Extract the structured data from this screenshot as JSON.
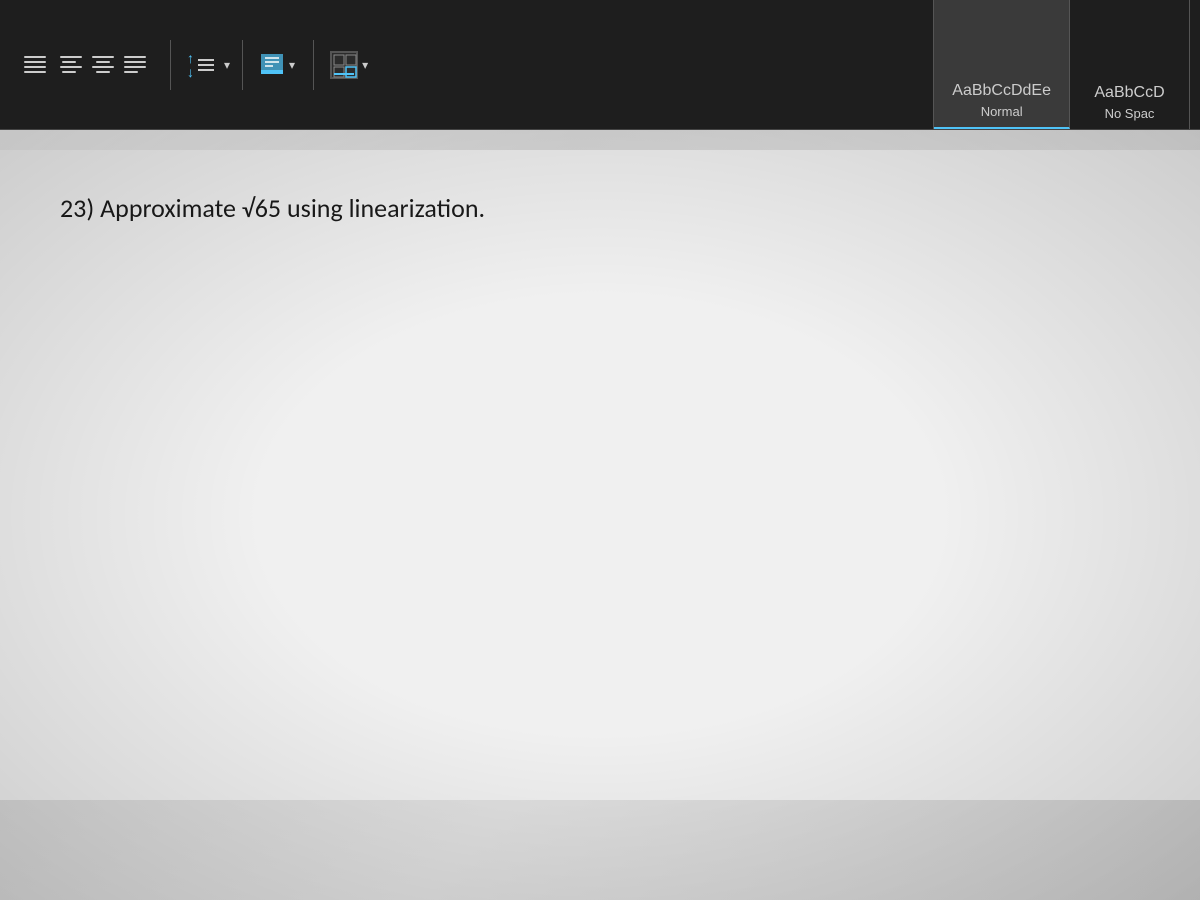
{
  "toolbar": {
    "align_left_label": "align left",
    "align_center_label": "align center",
    "align_right_label": "align right",
    "align_justify_label": "justify",
    "line_spacing_label": "line spacing",
    "shading_label": "shading",
    "borders_label": "borders",
    "chevron_label": "▾"
  },
  "styles_panel": {
    "items": [
      {
        "id": "normal",
        "sample_text": "AaBbCcDdEe",
        "label": "Normal",
        "active": true
      },
      {
        "id": "no_spacing",
        "sample_text": "AaBbCcD",
        "label": "No Spac",
        "active": false
      }
    ]
  },
  "document": {
    "question_number": "23)",
    "question_text": "Approximate √65 using linearization."
  }
}
